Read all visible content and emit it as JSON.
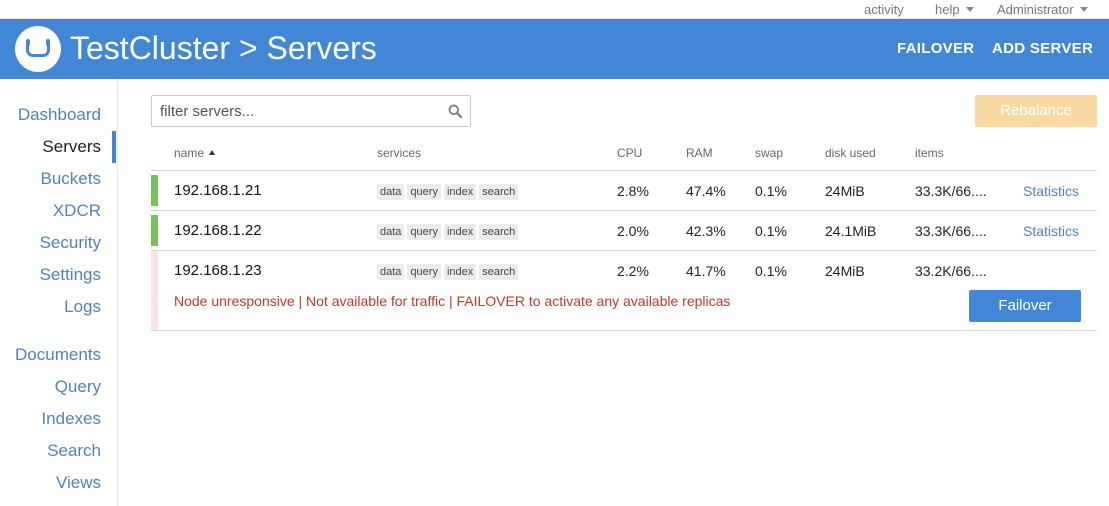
{
  "utilbar": {
    "activity": "activity",
    "help": "help",
    "user": "Administrator"
  },
  "header": {
    "title": "TestCluster > Servers",
    "failover": "FAILOVER",
    "add_server": "ADD SERVER"
  },
  "sidebar": {
    "items": [
      "Dashboard",
      "Servers",
      "Buckets",
      "XDCR",
      "Security",
      "Settings",
      "Logs",
      "Documents",
      "Query",
      "Indexes",
      "Search",
      "Views"
    ],
    "active": "Servers"
  },
  "filter": {
    "placeholder": "filter servers..."
  },
  "rebalance_label": "Rebalance",
  "table": {
    "columns": {
      "name": "name",
      "services": "services",
      "cpu": "CPU",
      "ram": "RAM",
      "swap": "swap",
      "disk": "disk used",
      "items": "items"
    },
    "sort_column": "name",
    "rows": [
      {
        "ip": "192.168.1.21",
        "services": [
          "data",
          "query",
          "index",
          "search"
        ],
        "cpu": "2.8%",
        "ram": "47.4%",
        "swap": "0.1%",
        "disk": "24MiB",
        "items": "33.3K/66....",
        "stats": "Statistics",
        "status": "healthy"
      },
      {
        "ip": "192.168.1.22",
        "services": [
          "data",
          "query",
          "index",
          "search"
        ],
        "cpu": "2.0%",
        "ram": "42.3%",
        "swap": "0.1%",
        "disk": "24.1MiB",
        "items": "33.3K/66....",
        "stats": "Statistics",
        "status": "healthy"
      },
      {
        "ip": "192.168.1.23",
        "services": [
          "data",
          "query",
          "index",
          "search"
        ],
        "cpu": "2.2%",
        "ram": "41.7%",
        "swap": "0.1%",
        "disk": "24MiB",
        "items": "33.2K/66....",
        "status": "unresponsive",
        "warning": "Node unresponsive | Not available for traffic | FAILOVER to activate any available replicas",
        "failover_button": "Failover"
      }
    ]
  },
  "colors": {
    "header": "#4287d6",
    "healthy": "#78c25a",
    "unresponsive": "#f8e4e4",
    "link": "#4f83c0",
    "warning": "#c0392b",
    "rebalance": "#f9d9a2"
  },
  "icons": {
    "search": "search-icon",
    "logo": "couchbase-logo-icon"
  }
}
